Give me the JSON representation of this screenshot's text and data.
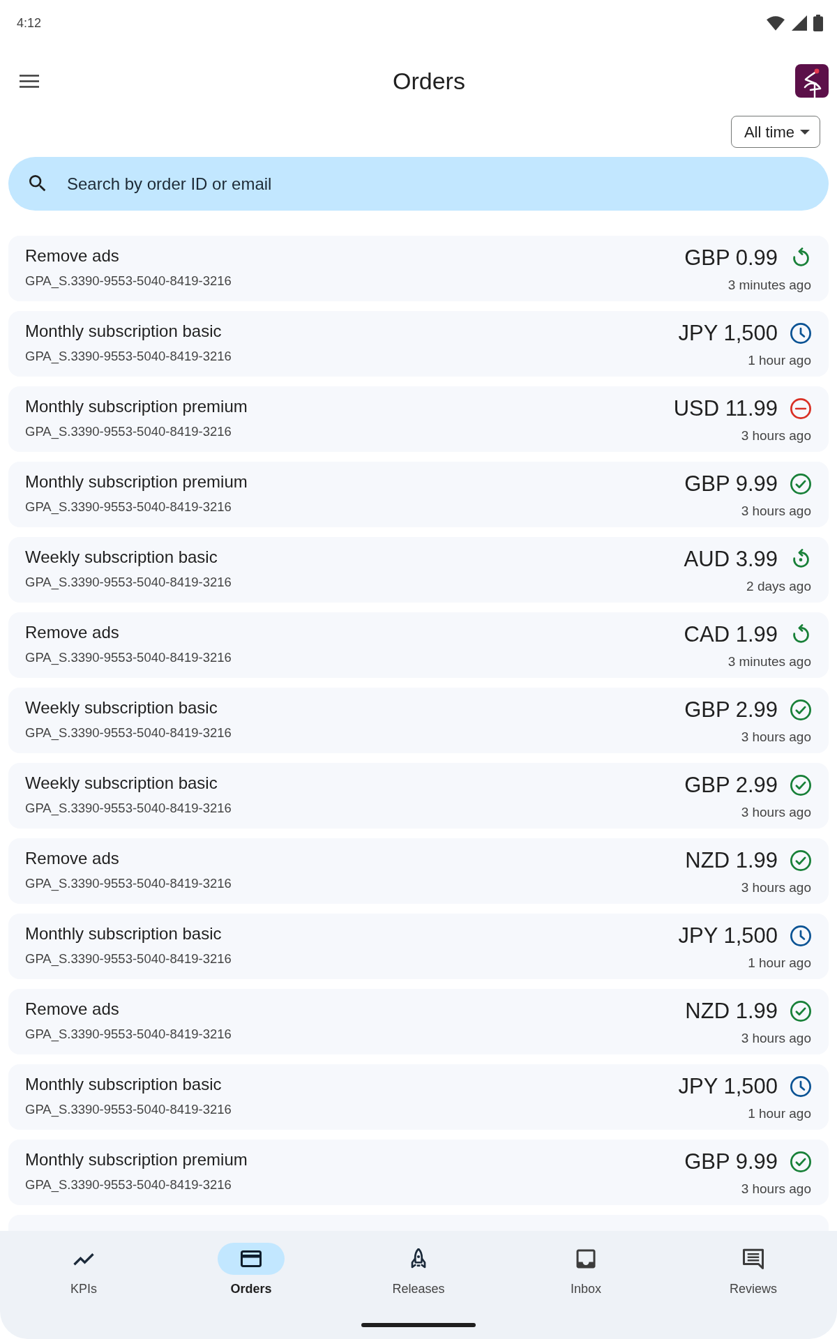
{
  "status_bar": {
    "time": "4:12"
  },
  "app_bar": {
    "title": "Orders"
  },
  "filter": {
    "label": "All time"
  },
  "search": {
    "placeholder": "Search by order ID or email"
  },
  "orders": [
    {
      "product": "Remove ads",
      "order_id": "GPA_S.3390-9553-5040-8419-3216",
      "amount": "GBP 0.99",
      "time": "3 minutes ago",
      "kind": "refunded"
    },
    {
      "product": "Monthly subscription basic",
      "order_id": "GPA_S.3390-9553-5040-8419-3216",
      "amount": "JPY 1,500",
      "time": "1 hour ago",
      "kind": "pending"
    },
    {
      "product": "Monthly subscription premium",
      "order_id": "GPA_S.3390-9553-5040-8419-3216",
      "amount": "USD 11.99",
      "time": "3 hours ago",
      "kind": "canceled"
    },
    {
      "product": "Monthly subscription premium",
      "order_id": "GPA_S.3390-9553-5040-8419-3216",
      "amount": "GBP 9.99",
      "time": "3 hours ago",
      "kind": "charged"
    },
    {
      "product": "Weekly subscription basic",
      "order_id": "GPA_S.3390-9553-5040-8419-3216",
      "amount": "AUD 3.99",
      "time": "2 days ago",
      "kind": "restored"
    },
    {
      "product": "Remove ads",
      "order_id": "GPA_S.3390-9553-5040-8419-3216",
      "amount": "CAD 1.99",
      "time": "3 minutes ago",
      "kind": "refunded"
    },
    {
      "product": "Weekly subscription basic",
      "order_id": "GPA_S.3390-9553-5040-8419-3216",
      "amount": "GBP 2.99",
      "time": "3 hours ago",
      "kind": "charged"
    },
    {
      "product": "Weekly subscription basic",
      "order_id": "GPA_S.3390-9553-5040-8419-3216",
      "amount": "GBP 2.99",
      "time": "3 hours ago",
      "kind": "charged"
    },
    {
      "product": "Remove ads",
      "order_id": "GPA_S.3390-9553-5040-8419-3216",
      "amount": "NZD 1.99",
      "time": "3 hours ago",
      "kind": "charged"
    },
    {
      "product": "Monthly subscription basic",
      "order_id": "GPA_S.3390-9553-5040-8419-3216",
      "amount": "JPY 1,500",
      "time": "1 hour ago",
      "kind": "pending"
    },
    {
      "product": "Remove ads",
      "order_id": "GPA_S.3390-9553-5040-8419-3216",
      "amount": "NZD 1.99",
      "time": "3 hours ago",
      "kind": "charged"
    },
    {
      "product": "Monthly subscription basic",
      "order_id": "GPA_S.3390-9553-5040-8419-3216",
      "amount": "JPY 1,500",
      "time": "1 hour ago",
      "kind": "pending"
    },
    {
      "product": "Monthly subscription premium",
      "order_id": "GPA_S.3390-9553-5040-8419-3216",
      "amount": "GBP 9.99",
      "time": "3 hours ago",
      "kind": "charged"
    }
  ],
  "bottom_nav": [
    {
      "label": "KPIs",
      "selected": false
    },
    {
      "label": "Orders",
      "selected": true
    },
    {
      "label": "Releases",
      "selected": false
    },
    {
      "label": "Inbox",
      "selected": false
    },
    {
      "label": "Reviews",
      "selected": false
    }
  ]
}
